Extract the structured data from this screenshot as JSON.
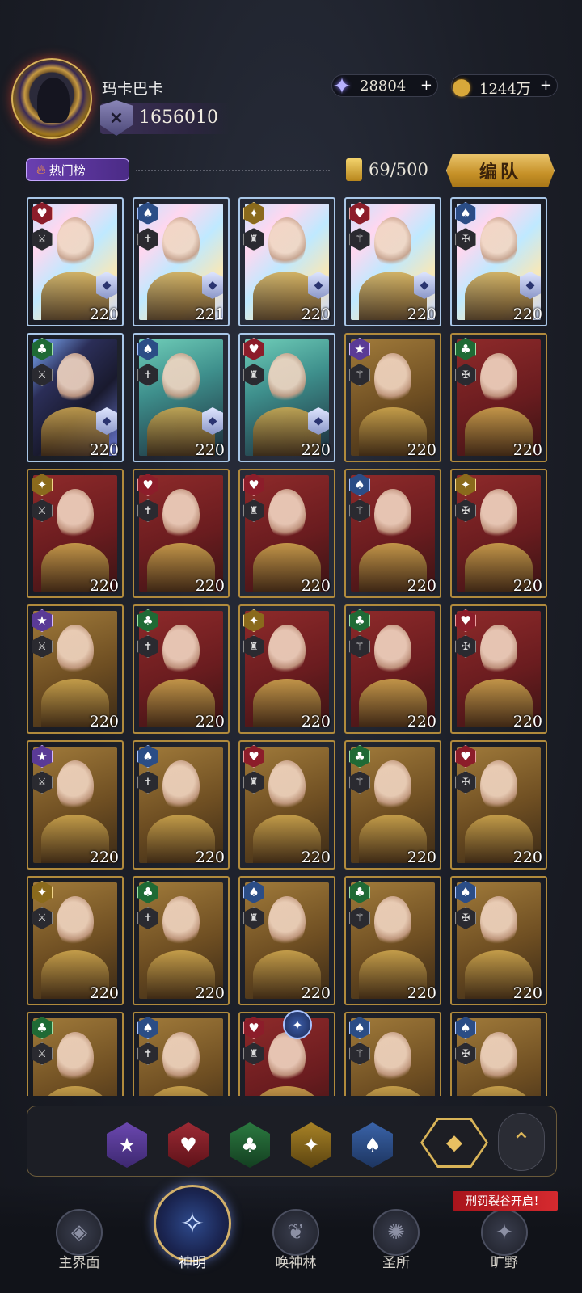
{
  "player": {
    "name": "玛卡巴卡",
    "power": "1656010"
  },
  "resources": {
    "crystal": "28804",
    "gold": "1244万",
    "plus": "+"
  },
  "header": {
    "hot_tag": "热门榜",
    "card_count": "69/500",
    "team_button": "编队"
  },
  "suits": {
    "heart": "♥",
    "spade": "♠",
    "diamond": "✦",
    "club": "♣",
    "star": "★"
  },
  "cards": [
    {
      "suit": "heart",
      "bg": "holo",
      "level": "220",
      "badge": true
    },
    {
      "suit": "spade",
      "bg": "holo",
      "level": "221",
      "badge": true
    },
    {
      "suit": "diamond",
      "bg": "holo",
      "level": "220",
      "badge": true
    },
    {
      "suit": "heart",
      "bg": "holo",
      "level": "220",
      "badge": true
    },
    {
      "suit": "spade",
      "bg": "holo",
      "level": "220",
      "badge": true
    },
    {
      "suit": "club",
      "bg": "holodark",
      "level": "220",
      "badge": true
    },
    {
      "suit": "spade",
      "bg": "teal",
      "level": "220",
      "badge": true
    },
    {
      "suit": "heart",
      "bg": "teal",
      "level": "220",
      "badge": true
    },
    {
      "suit": "star",
      "bg": "gold",
      "level": "220",
      "badge": false
    },
    {
      "suit": "club",
      "bg": "red",
      "level": "220",
      "badge": false
    },
    {
      "suit": "diamond",
      "bg": "red",
      "level": "220",
      "badge": false
    },
    {
      "suit": "heart",
      "bg": "red",
      "level": "220",
      "badge": false
    },
    {
      "suit": "heart",
      "bg": "red",
      "level": "220",
      "badge": false
    },
    {
      "suit": "spade",
      "bg": "red",
      "level": "220",
      "badge": false
    },
    {
      "suit": "diamond",
      "bg": "red",
      "level": "220",
      "badge": false
    },
    {
      "suit": "star",
      "bg": "gold",
      "level": "220",
      "badge": false
    },
    {
      "suit": "club",
      "bg": "red",
      "level": "220",
      "badge": false
    },
    {
      "suit": "diamond",
      "bg": "red",
      "level": "220",
      "badge": false
    },
    {
      "suit": "club",
      "bg": "red",
      "level": "220",
      "badge": false
    },
    {
      "suit": "heart",
      "bg": "red",
      "level": "220",
      "badge": false
    },
    {
      "suit": "star",
      "bg": "gold",
      "level": "220",
      "badge": false
    },
    {
      "suit": "spade",
      "bg": "gold",
      "level": "220",
      "badge": false
    },
    {
      "suit": "heart",
      "bg": "gold",
      "level": "220",
      "badge": false
    },
    {
      "suit": "club",
      "bg": "gold",
      "level": "220",
      "badge": false
    },
    {
      "suit": "heart",
      "bg": "gold",
      "level": "220",
      "badge": false
    },
    {
      "suit": "diamond",
      "bg": "gold",
      "level": "220",
      "badge": false
    },
    {
      "suit": "club",
      "bg": "gold",
      "level": "220",
      "badge": false
    },
    {
      "suit": "spade",
      "bg": "gold",
      "level": "220",
      "badge": false
    },
    {
      "suit": "club",
      "bg": "gold",
      "level": "220",
      "badge": false
    },
    {
      "suit": "spade",
      "bg": "gold",
      "level": "220",
      "badge": false
    },
    {
      "suit": "club",
      "bg": "gold",
      "level": "",
      "badge": false
    },
    {
      "suit": "spade",
      "bg": "gold",
      "level": "",
      "badge": false
    },
    {
      "suit": "heart",
      "bg": "red",
      "level": "",
      "badge": false
    },
    {
      "suit": "spade",
      "bg": "gold",
      "level": "",
      "badge": false
    },
    {
      "suit": "spade",
      "bg": "gold",
      "level": "",
      "badge": false
    }
  ],
  "filters": {
    "star": "★",
    "heart": "♥",
    "club": "♣",
    "diamond": "✦",
    "spade": "♠",
    "all": "◆",
    "collapse": "⌃"
  },
  "nav": {
    "event": "刑罚裂谷开启！",
    "items": [
      {
        "label": "主界面",
        "icon": "◈"
      },
      {
        "label": "神明",
        "icon": "✧"
      },
      {
        "label": "唤神林",
        "icon": "❦"
      },
      {
        "label": "圣所",
        "icon": "✺"
      },
      {
        "label": "旷野",
        "icon": "✦"
      }
    ]
  }
}
